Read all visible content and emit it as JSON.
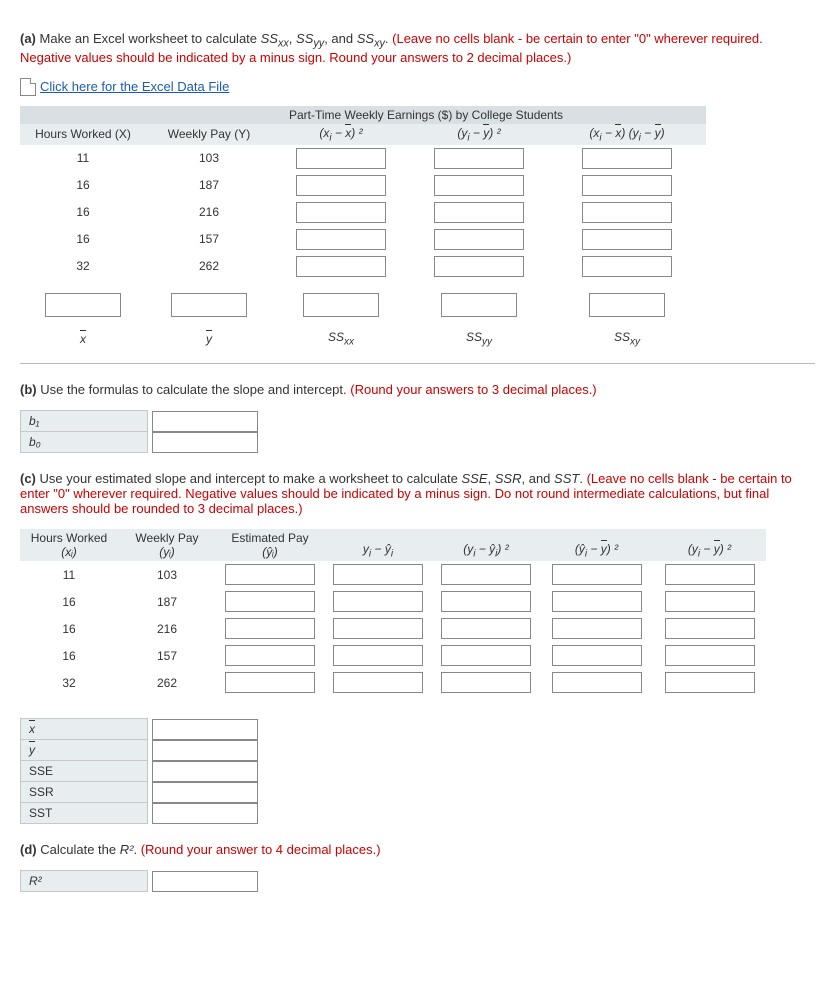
{
  "partA": {
    "label": "(a)",
    "text1": "Make an Excel worksheet to calculate ",
    "m1": "SS",
    "m1s": "xx",
    "m1a": ", ",
    "m2": "SS",
    "m2s": "yy",
    "m2a": ", and ",
    "m3": "SS",
    "m3s": "xy",
    "m3a": ". ",
    "red": "(Leave no cells blank - be certain to enter \"0\" wherever required. Negative values should be indicated by a minus sign. Round your answers to 2 decimal places.)",
    "linkText": "Click here for the Excel Data File",
    "tableTitle": "Part-Time Weekly Earnings ($) by College Students",
    "headers": {
      "h1": "Hours Worked (X)",
      "h2": "Weekly Pay (Y)",
      "h3": "(xᵢ − x̄) ²",
      "h4": "(yᵢ − ȳ) ²",
      "h5": "(xᵢ − x̄) (yᵢ − ȳ)"
    },
    "rows": [
      {
        "x": "11",
        "y": "103"
      },
      {
        "x": "16",
        "y": "187"
      },
      {
        "x": "16",
        "y": "216"
      },
      {
        "x": "16",
        "y": "157"
      },
      {
        "x": "32",
        "y": "262"
      }
    ],
    "sumLabels": {
      "l1": "x̄",
      "l2": "ȳ",
      "l3": "SS",
      "l3s": "xx",
      "l4": "SS",
      "l4s": "yy",
      "l5": "SS",
      "l5s": "xy"
    }
  },
  "partB": {
    "label": "(b)",
    "text": "Use the formulas to calculate the slope and intercept. ",
    "red": "(Round your answers to 3 decimal places.)",
    "b1": "b₁",
    "b0": "b₀"
  },
  "partC": {
    "label": "(c)",
    "text1": "Use your estimated slope and intercept to make a worksheet to calculate ",
    "m1": "SSE",
    "sep1": ", ",
    "m2": "SSR",
    "sep2": ", and ",
    "m3": "SST",
    "dot": ". ",
    "red": "(Leave no cells blank - be certain to enter \"0\" wherever required. Negative values should be indicated by a minus sign. Do not round intermediate calculations, but final answers should be rounded to 3 decimal places.)",
    "headers": {
      "h1a": "Hours Worked",
      "h1b": "(xᵢ)",
      "h2a": "Weekly Pay",
      "h2b": "(yᵢ)",
      "h3a": "Estimated Pay",
      "h3b": "(ŷᵢ)",
      "h4": "yᵢ − ŷᵢ",
      "h5": "(yᵢ − ŷᵢ) ²",
      "h6": "(ŷᵢ − ȳ) ²",
      "h7": "(yᵢ − ȳ) ²"
    },
    "rows": [
      {
        "x": "11",
        "y": "103"
      },
      {
        "x": "16",
        "y": "187"
      },
      {
        "x": "16",
        "y": "216"
      },
      {
        "x": "16",
        "y": "157"
      },
      {
        "x": "32",
        "y": "262"
      }
    ],
    "sumLabels": {
      "l1": "x̄",
      "l2": "ȳ",
      "l3": "SSE",
      "l4": "SSR",
      "l5": "SST"
    }
  },
  "partD": {
    "label": "(d)",
    "text": "Calculate the ",
    "r2": "R²",
    "dot": ". ",
    "red": "(Round your answer to 4 decimal places.)",
    "rowLabel": "R²"
  }
}
